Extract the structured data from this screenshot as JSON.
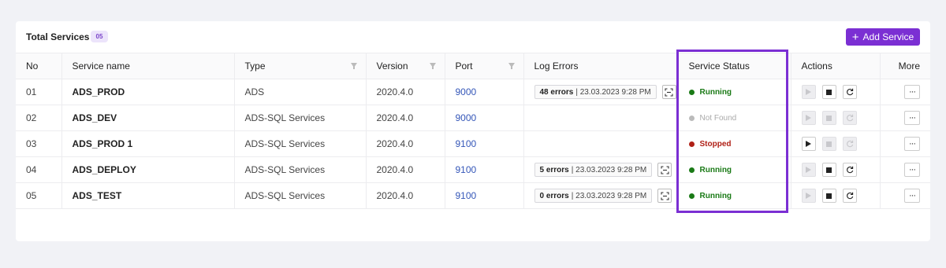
{
  "header": {
    "title": "Total Services",
    "count": "05",
    "add_button": "Add Service",
    "add_icon": "+"
  },
  "columns": {
    "no": "No",
    "name": "Service name",
    "type": "Type",
    "version": "Version",
    "port": "Port",
    "log": "Log Errors",
    "status": "Service Status",
    "actions": "Actions",
    "more": "More"
  },
  "rows": [
    {
      "no": "01",
      "name": "ADS_PROD",
      "type": "ADS",
      "version": "2020.4.0",
      "port": "9000",
      "errors": "48 errors",
      "errdate": "| 23.03.2023 9:28 PM",
      "status": "Running",
      "status_kind": "running",
      "play_enabled": false,
      "stop_enabled": true,
      "restart_enabled": true
    },
    {
      "no": "02",
      "name": "ADS_DEV",
      "type": "ADS-SQL Services",
      "version": "2020.4.0",
      "port": "9000",
      "errors": "",
      "errdate": "",
      "status": "Not Found",
      "status_kind": "notfound",
      "play_enabled": false,
      "stop_enabled": false,
      "restart_enabled": false
    },
    {
      "no": "03",
      "name": "ADS_PROD 1",
      "type": "ADS-SQL Services",
      "version": "2020.4.0",
      "port": "9100",
      "errors": "",
      "errdate": "",
      "status": "Stopped",
      "status_kind": "stopped",
      "play_enabled": true,
      "stop_enabled": false,
      "restart_enabled": false
    },
    {
      "no": "04",
      "name": "ADS_DEPLOY",
      "type": "ADS-SQL Services",
      "version": "2020.4.0",
      "port": "9100",
      "errors": "5 errors",
      "errdate": "| 23.03.2023 9:28 PM",
      "status": "Running",
      "status_kind": "running",
      "play_enabled": false,
      "stop_enabled": true,
      "restart_enabled": true
    },
    {
      "no": "05",
      "name": "ADS_TEST",
      "type": "ADS-SQL Services",
      "version": "2020.4.0",
      "port": "9100",
      "errors": "0 errors",
      "errdate": "| 23.03.2023 9:28 PM",
      "status": "Running",
      "status_kind": "running",
      "play_enabled": false,
      "stop_enabled": true,
      "restart_enabled": true
    }
  ],
  "more_label": "···",
  "colors": {
    "accent": "#7b2fd3",
    "running": "#1a7a16",
    "stopped": "#b02016",
    "notfound": "#aaaaaa",
    "port_link": "#3456b8"
  }
}
